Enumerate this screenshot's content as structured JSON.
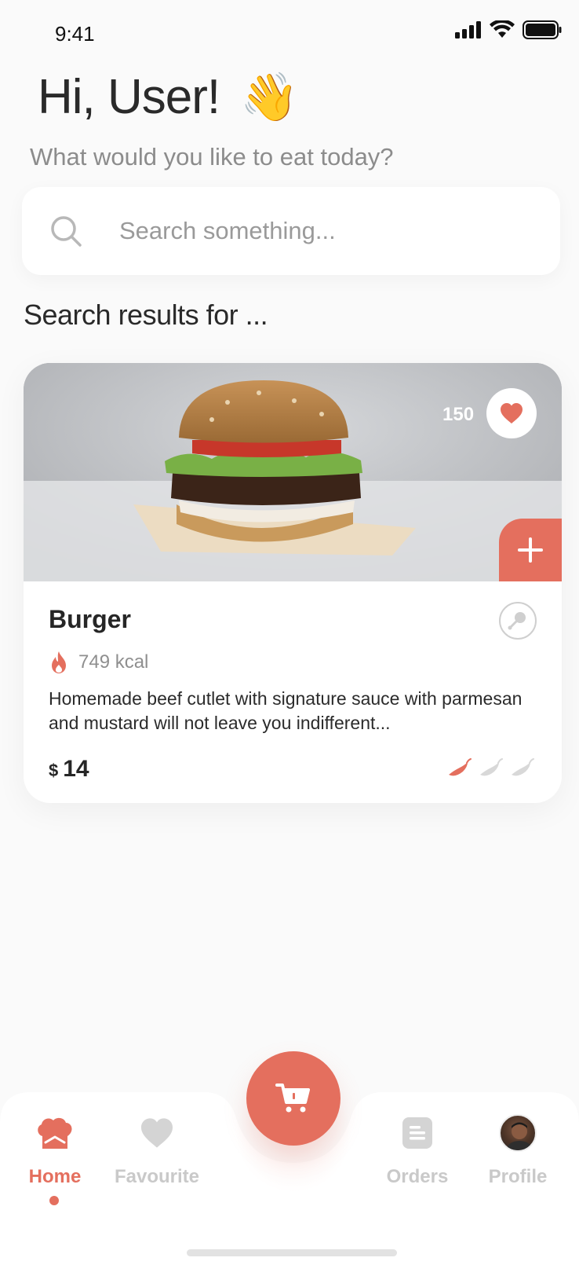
{
  "status_bar": {
    "time": "9:41"
  },
  "greeting": {
    "title": "Hi, User!",
    "emoji": "👋",
    "subtitle": "What would you like to eat today?"
  },
  "search": {
    "placeholder": "Search something..."
  },
  "results_heading": "Search results for ...",
  "product": {
    "name": "Burger",
    "likes": "150",
    "kcal": "749 kcal",
    "description": "Homemade beef cutlet with signature sauce with parmesan and mustard will not leave you indifferent...",
    "currency": "$",
    "price": "14",
    "spice_level": 1,
    "spice_max": 3
  },
  "nav": {
    "items": [
      {
        "label": "Home",
        "icon": "chef-hat-icon",
        "active": true
      },
      {
        "label": "Favourite",
        "icon": "heart-icon",
        "active": false
      },
      {
        "label": "Orders",
        "icon": "orders-icon",
        "active": false
      },
      {
        "label": "Profile",
        "icon": "avatar",
        "active": false
      }
    ]
  },
  "colors": {
    "accent": "#e46f5e",
    "muted": "#c9c9c9",
    "background": "#fafafa"
  }
}
